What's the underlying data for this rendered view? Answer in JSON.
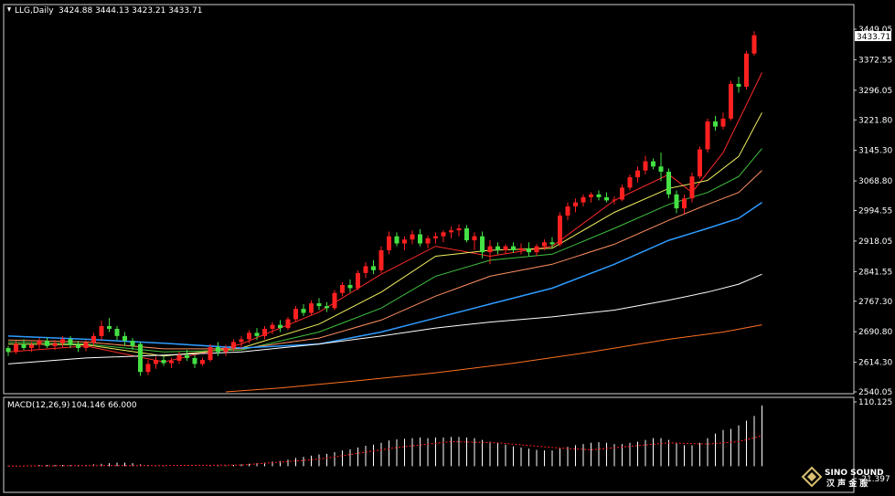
{
  "chart_title": {
    "symbol": "LLG,Daily",
    "ohlc": "3424.88 3444.13 3423.21 3433.71"
  },
  "macd_title": {
    "label": "MACD(12,26,9)",
    "values": "104.146 66.000"
  },
  "watermark": {
    "brand": "SINO SOUND",
    "sub": "汉 声 金 服"
  },
  "colors": {
    "background": "#000000",
    "bull_candle": "#ff2020",
    "bear_candle": "#44e044",
    "ma_red": "#ff2a2a",
    "ma_yellow": "#f0f060",
    "ma_green": "#40c040",
    "ma_salmon": "#ff9060",
    "ma_blue": "#2f9bff",
    "ma_white": "#ffffff",
    "ma_orange": "#ff7020",
    "macd_bars": "#ffffff",
    "macd_signal": "#ff2020"
  },
  "chart_data": [
    {
      "type": "candlestick",
      "title": "LLG,Daily",
      "ylim": [
        2540.05,
        3449.05
      ],
      "yticks": [
        "3449.05",
        "3372.55",
        "3296.05",
        "3221.80",
        "3145.30",
        "3068.80",
        "2994.55",
        "2918.05",
        "2841.55",
        "2767.30",
        "2690.80",
        "2614.30",
        "2540.05"
      ],
      "current_price": "3433.71",
      "candles": [
        [
          2650,
          2655,
          2630,
          2640
        ],
        [
          2640,
          2668,
          2635,
          2660
        ],
        [
          2660,
          2672,
          2645,
          2650
        ],
        [
          2650,
          2665,
          2640,
          2658
        ],
        [
          2658,
          2675,
          2648,
          2668
        ],
        [
          2668,
          2676,
          2650,
          2655
        ],
        [
          2655,
          2670,
          2645,
          2662
        ],
        [
          2662,
          2680,
          2652,
          2672
        ],
        [
          2672,
          2680,
          2650,
          2658
        ],
        [
          2658,
          2668,
          2640,
          2650
        ],
        [
          2650,
          2670,
          2642,
          2664
        ],
        [
          2664,
          2688,
          2655,
          2680
        ],
        [
          2680,
          2718,
          2670,
          2705
        ],
        [
          2705,
          2725,
          2690,
          2698
        ],
        [
          2698,
          2705,
          2670,
          2680
        ],
        [
          2680,
          2690,
          2655,
          2668
        ],
        [
          2668,
          2675,
          2645,
          2655
        ],
        [
          2660,
          2665,
          2580,
          2590
        ],
        [
          2590,
          2620,
          2582,
          2610
        ],
        [
          2610,
          2628,
          2598,
          2620
        ],
        [
          2620,
          2630,
          2605,
          2612
        ],
        [
          2612,
          2625,
          2600,
          2618
        ],
        [
          2618,
          2640,
          2610,
          2632
        ],
        [
          2632,
          2645,
          2618,
          2625
        ],
        [
          2625,
          2632,
          2600,
          2610
        ],
        [
          2610,
          2626,
          2605,
          2620
        ],
        [
          2620,
          2660,
          2615,
          2652
        ],
        [
          2652,
          2665,
          2630,
          2640
        ],
        [
          2640,
          2658,
          2630,
          2650
        ],
        [
          2650,
          2672,
          2642,
          2665
        ],
        [
          2665,
          2680,
          2650,
          2672
        ],
        [
          2672,
          2695,
          2662,
          2688
        ],
        [
          2688,
          2700,
          2670,
          2680
        ],
        [
          2680,
          2705,
          2672,
          2698
        ],
        [
          2698,
          2715,
          2685,
          2708
        ],
        [
          2708,
          2720,
          2690,
          2700
        ],
        [
          2700,
          2728,
          2695,
          2722
        ],
        [
          2722,
          2755,
          2715,
          2748
        ],
        [
          2748,
          2760,
          2730,
          2738
        ],
        [
          2738,
          2770,
          2732,
          2762
        ],
        [
          2762,
          2775,
          2745,
          2755
        ],
        [
          2755,
          2765,
          2740,
          2750
        ],
        [
          2750,
          2795,
          2745,
          2788
        ],
        [
          2788,
          2815,
          2780,
          2808
        ],
        [
          2808,
          2822,
          2790,
          2800
        ],
        [
          2800,
          2845,
          2795,
          2838
        ],
        [
          2838,
          2865,
          2825,
          2855
        ],
        [
          2855,
          2870,
          2835,
          2845
        ],
        [
          2845,
          2905,
          2838,
          2895
        ],
        [
          2895,
          2942,
          2885,
          2930
        ],
        [
          2930,
          2940,
          2905,
          2912
        ],
        [
          2912,
          2930,
          2895,
          2922
        ],
        [
          2922,
          2945,
          2910,
          2935
        ],
        [
          2935,
          2948,
          2905,
          2912
        ],
        [
          2912,
          2932,
          2900,
          2925
        ],
        [
          2925,
          2940,
          2912,
          2930
        ],
        [
          2930,
          2945,
          2915,
          2940
        ],
        [
          2940,
          2955,
          2925,
          2945
        ],
        [
          2945,
          2960,
          2930,
          2950
        ],
        [
          2950,
          2958,
          2915,
          2920
        ],
        [
          2920,
          2940,
          2895,
          2930
        ],
        [
          2930,
          2942,
          2875,
          2890
        ],
        [
          2890,
          2920,
          2860,
          2905
        ],
        [
          2905,
          2915,
          2885,
          2895
        ],
        [
          2895,
          2910,
          2885,
          2905
        ],
        [
          2905,
          2915,
          2888,
          2895
        ],
        [
          2895,
          2912,
          2885,
          2900
        ],
        [
          2900,
          2915,
          2880,
          2890
        ],
        [
          2890,
          2910,
          2880,
          2905
        ],
        [
          2905,
          2922,
          2895,
          2915
        ],
        [
          2915,
          2928,
          2900,
          2910
        ],
        [
          2910,
          2990,
          2905,
          2982
        ],
        [
          2982,
          3015,
          2970,
          3005
        ],
        [
          3005,
          3025,
          2990,
          3015
        ],
        [
          3015,
          3035,
          3005,
          3028
        ],
        [
          3028,
          3040,
          3015,
          3035
        ],
        [
          3035,
          3045,
          3020,
          3028
        ],
        [
          3028,
          3040,
          3015,
          3020
        ],
        [
          3020,
          3030,
          3010,
          3022
        ],
        [
          3022,
          3060,
          3018,
          3052
        ],
        [
          3052,
          3085,
          3045,
          3078
        ],
        [
          3078,
          3105,
          3065,
          3095
        ],
        [
          3095,
          3132,
          3085,
          3118
        ],
        [
          3118,
          3125,
          3098,
          3105
        ],
        [
          3105,
          3140,
          3068,
          3092
        ],
        [
          3092,
          3100,
          3025,
          3035
        ],
        [
          3035,
          3045,
          2988,
          3000
        ],
        [
          3000,
          3035,
          2985,
          3025
        ],
        [
          3025,
          3090,
          3015,
          3080
        ],
        [
          3080,
          3155,
          3075,
          3148
        ],
        [
          3148,
          3225,
          3140,
          3218
        ],
        [
          3218,
          3232,
          3195,
          3205
        ],
        [
          3205,
          3240,
          3198,
          3225
        ],
        [
          3225,
          3320,
          3220,
          3312
        ],
        [
          3312,
          3330,
          3290,
          3305
        ],
        [
          3305,
          3395,
          3298,
          3388
        ],
        [
          3388,
          3444,
          3383,
          3434
        ]
      ],
      "moving_averages": [
        {
          "name": "red",
          "points": [
            [
              0,
              2640
            ],
            [
              10,
              2655
            ],
            [
              20,
              2615
            ],
            [
              30,
              2660
            ],
            [
              40,
              2740
            ],
            [
              48,
              2835
            ],
            [
              55,
              2905
            ],
            [
              62,
              2880
            ],
            [
              70,
              2905
            ],
            [
              78,
              3020
            ],
            [
              85,
              3085
            ],
            [
              88,
              3040
            ],
            [
              92,
              3140
            ],
            [
              97,
              3340
            ]
          ]
        },
        {
          "name": "yellow",
          "points": [
            [
              0,
              2660
            ],
            [
              10,
              2658
            ],
            [
              20,
              2630
            ],
            [
              30,
              2650
            ],
            [
              40,
              2710
            ],
            [
              48,
              2790
            ],
            [
              55,
              2880
            ],
            [
              62,
              2895
            ],
            [
              70,
              2900
            ],
            [
              78,
              2990
            ],
            [
              85,
              3050
            ],
            [
              90,
              3070
            ],
            [
              94,
              3130
            ],
            [
              97,
              3240
            ]
          ]
        },
        {
          "name": "green",
          "points": [
            [
              0,
              2665
            ],
            [
              10,
              2660
            ],
            [
              20,
              2640
            ],
            [
              30,
              2645
            ],
            [
              40,
              2690
            ],
            [
              48,
              2750
            ],
            [
              55,
              2830
            ],
            [
              62,
              2870
            ],
            [
              70,
              2885
            ],
            [
              78,
              2950
            ],
            [
              85,
              3010
            ],
            [
              90,
              3040
            ],
            [
              94,
              3080
            ],
            [
              97,
              3150
            ]
          ]
        },
        {
          "name": "salmon",
          "points": [
            [
              0,
              2670
            ],
            [
              10,
              2665
            ],
            [
              20,
              2648
            ],
            [
              30,
              2648
            ],
            [
              40,
              2675
            ],
            [
              48,
              2720
            ],
            [
              55,
              2780
            ],
            [
              62,
              2830
            ],
            [
              70,
              2860
            ],
            [
              78,
              2910
            ],
            [
              85,
              2970
            ],
            [
              90,
              3010
            ],
            [
              94,
              3040
            ],
            [
              97,
              3095
            ]
          ]
        },
        {
          "name": "blue",
          "points": [
            [
              0,
              2680
            ],
            [
              10,
              2672
            ],
            [
              20,
              2662
            ],
            [
              30,
              2650
            ],
            [
              40,
              2660
            ],
            [
              48,
              2690
            ],
            [
              55,
              2725
            ],
            [
              62,
              2760
            ],
            [
              70,
              2800
            ],
            [
              78,
              2860
            ],
            [
              85,
              2920
            ],
            [
              90,
              2950
            ],
            [
              94,
              2975
            ],
            [
              97,
              3015
            ]
          ]
        },
        {
          "name": "white",
          "points": [
            [
              0,
              2610
            ],
            [
              10,
              2625
            ],
            [
              20,
              2632
            ],
            [
              30,
              2640
            ],
            [
              40,
              2660
            ],
            [
              48,
              2680
            ],
            [
              55,
              2700
            ],
            [
              62,
              2715
            ],
            [
              70,
              2728
            ],
            [
              78,
              2745
            ],
            [
              85,
              2770
            ],
            [
              90,
              2790
            ],
            [
              94,
              2810
            ],
            [
              97,
              2835
            ]
          ]
        },
        {
          "name": "orange",
          "points": [
            [
              28,
              2540
            ],
            [
              35,
              2550
            ],
            [
              45,
              2568
            ],
            [
              55,
              2588
            ],
            [
              65,
              2612
            ],
            [
              75,
              2640
            ],
            [
              85,
              2672
            ],
            [
              92,
              2690
            ],
            [
              97,
              2708
            ]
          ]
        }
      ]
    },
    {
      "type": "bar",
      "title": "MACD(12,26,9) 104.146 66.000",
      "ylim": [
        -21.397,
        110.125
      ],
      "yticks": [
        "110.125",
        "-21.397"
      ],
      "histogram": [
        1,
        1,
        1,
        1,
        2,
        2,
        2,
        2,
        2,
        2,
        2,
        3,
        4,
        5,
        6,
        6,
        5,
        3,
        2,
        1,
        1,
        0,
        0,
        0,
        0,
        0,
        1,
        1,
        1,
        2,
        3,
        4,
        5,
        6,
        8,
        9,
        11,
        14,
        16,
        18,
        20,
        21,
        24,
        27,
        29,
        32,
        35,
        37,
        40,
        44,
        46,
        47,
        48,
        49,
        48,
        49,
        49,
        50,
        50,
        49,
        48,
        45,
        42,
        40,
        37,
        34,
        32,
        30,
        28,
        27,
        27,
        30,
        33,
        36,
        38,
        40,
        41,
        40,
        38,
        38,
        40,
        42,
        45,
        48,
        48,
        45,
        40,
        36,
        36,
        40,
        48,
        56,
        62,
        64,
        70,
        78,
        86,
        104
      ],
      "signal": [
        [
          0,
          0
        ],
        [
          10,
          1
        ],
        [
          20,
          1
        ],
        [
          30,
          2
        ],
        [
          40,
          12
        ],
        [
          50,
          32
        ],
        [
          57,
          42
        ],
        [
          63,
          40
        ],
        [
          70,
          32
        ],
        [
          75,
          28
        ],
        [
          80,
          34
        ],
        [
          85,
          40
        ],
        [
          90,
          38
        ],
        [
          94,
          42
        ],
        [
          97,
          52
        ]
      ]
    }
  ]
}
